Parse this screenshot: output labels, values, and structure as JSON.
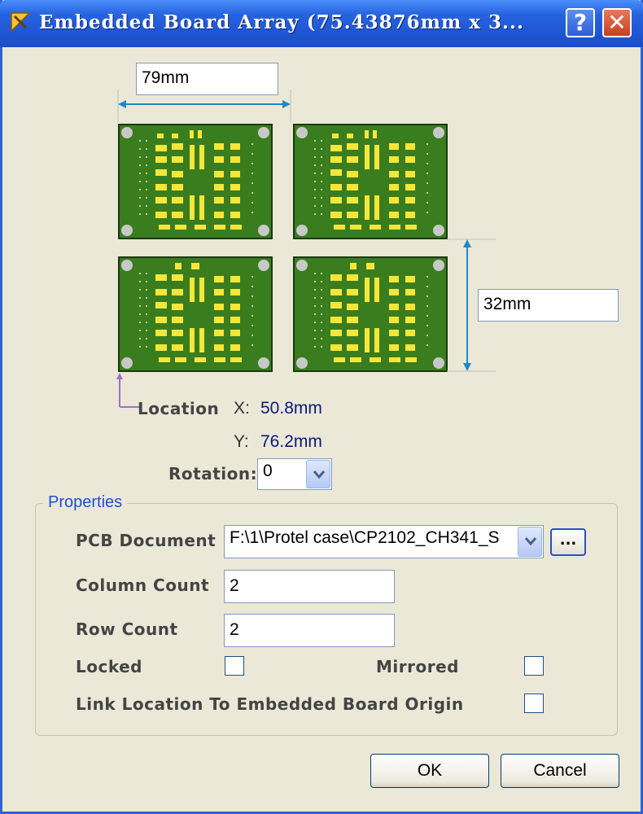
{
  "window": {
    "title": "Embedded Board Array (75.43876mm x 3..."
  },
  "titlebar_buttons": {
    "help": "?",
    "close": "✕"
  },
  "dimensions": {
    "width_value": "79mm",
    "height_value": "32mm"
  },
  "location": {
    "label": "Location",
    "x_label": "X:",
    "x_value": "50.8mm",
    "y_label": "Y:",
    "y_value": "76.2mm"
  },
  "rotation": {
    "label": "Rotation:",
    "value": "0"
  },
  "properties": {
    "title": "Properties",
    "pcb_document_label": "PCB Document",
    "pcb_document_value": "F:\\1\\Protel case\\CP2102_CH341_S",
    "browse_label": "...",
    "column_count_label": "Column Count",
    "column_count_value": "2",
    "row_count_label": "Row Count",
    "row_count_value": "2",
    "locked_label": "Locked",
    "locked_checked": false,
    "mirrored_label": "Mirrored",
    "mirrored_checked": false,
    "link_label": "Link Location To Embedded Board Origin",
    "link_checked": false
  },
  "buttons": {
    "ok": "OK",
    "cancel": "Cancel"
  },
  "colors": {
    "board_green": "#3a7d1f",
    "pad_yellow": "#f5e63a",
    "dimension_blue": "#1e8ac8",
    "origin_marker": "#a070c8"
  }
}
